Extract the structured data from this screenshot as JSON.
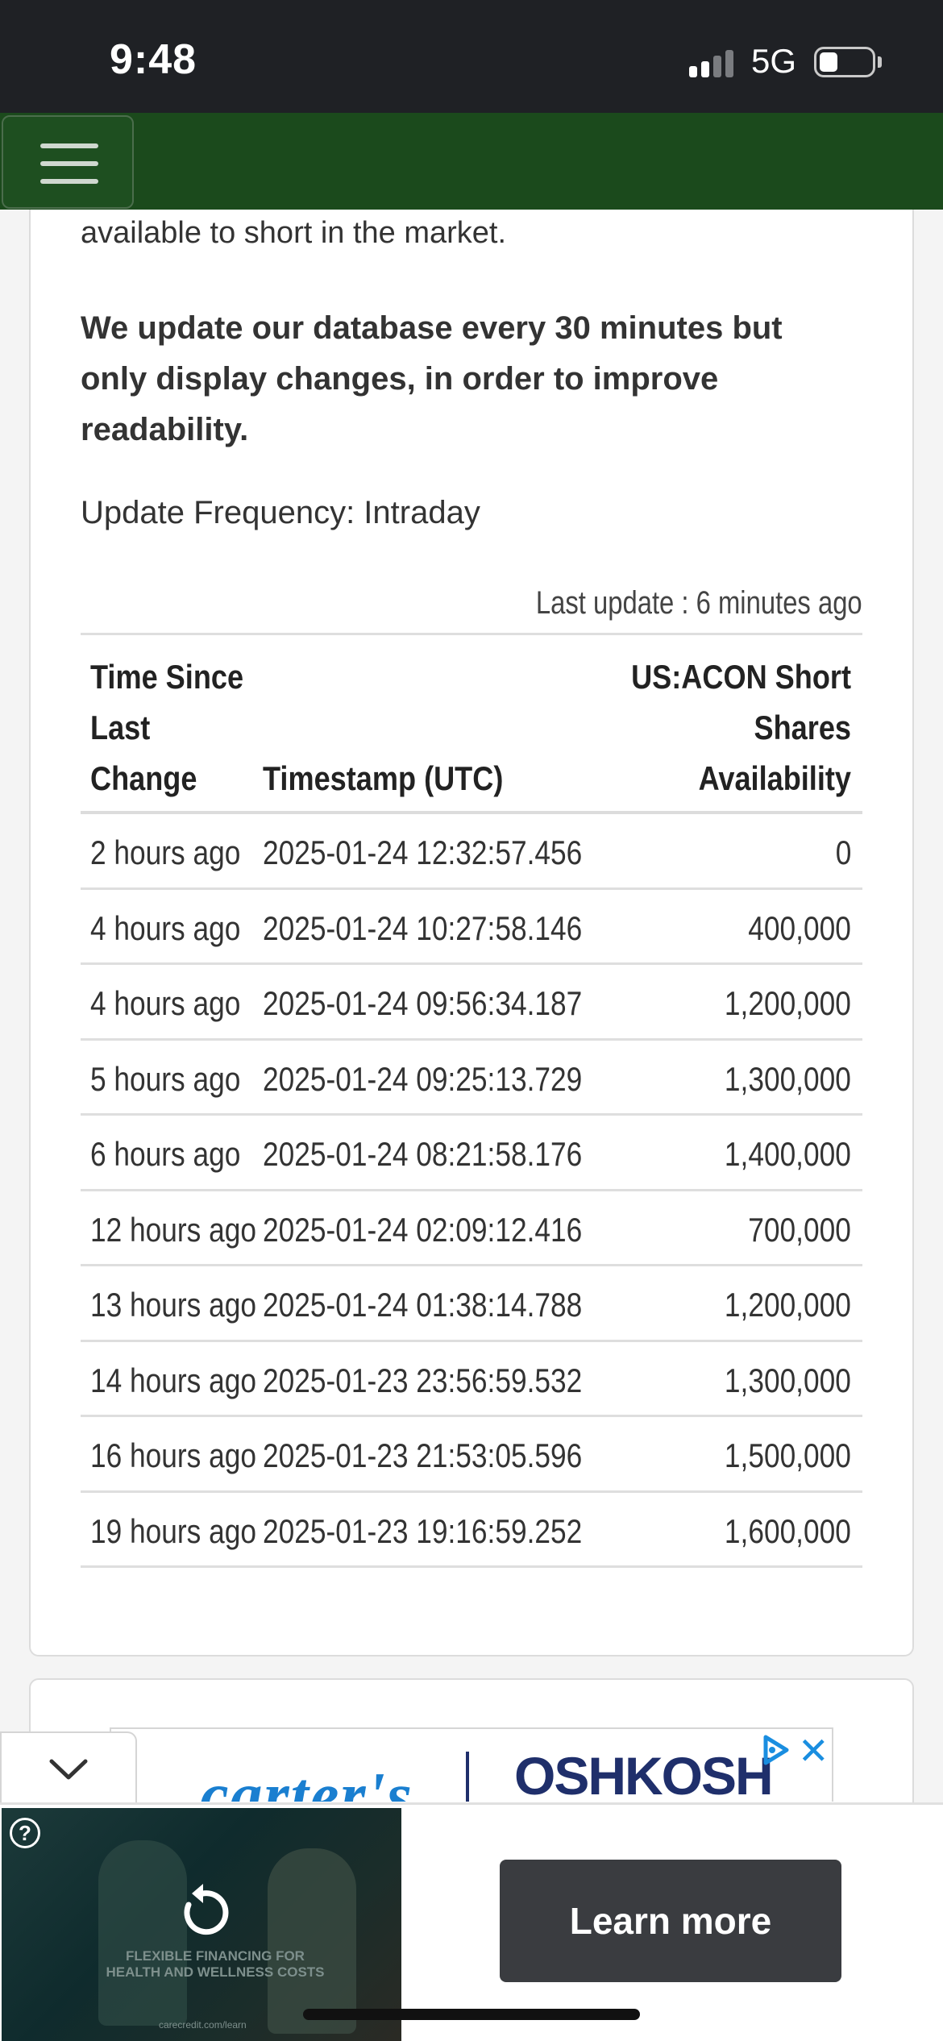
{
  "status_bar": {
    "time": "9:48",
    "network": "5G",
    "battery_level": 0.3
  },
  "nav": {
    "menu_icon": "hamburger-icon",
    "color": "#1b4a1c"
  },
  "content": {
    "intro_tail": "available to short in the market.",
    "update_note": "We update our database every 30 minutes but only display changes, in order to improve readability.",
    "frequency": "Update Frequency: Intraday",
    "last_update": "Last update : 6 minutes ago"
  },
  "table": {
    "headers": {
      "since": "Time Since Last Change",
      "timestamp": "Timestamp (UTC)",
      "availability": "US:ACON Short Shares Availability"
    },
    "rows": [
      {
        "since": "2 hours ago",
        "timestamp": "2025-01-24 12:32:57.456",
        "value": "0"
      },
      {
        "since": "4 hours ago",
        "timestamp": "2025-01-24 10:27:58.146",
        "value": "400,000"
      },
      {
        "since": "4 hours ago",
        "timestamp": "2025-01-24 09:56:34.187",
        "value": "1,200,000"
      },
      {
        "since": "5 hours ago",
        "timestamp": "2025-01-24 09:25:13.729",
        "value": "1,300,000"
      },
      {
        "since": "6 hours ago",
        "timestamp": "2025-01-24 08:21:58.176",
        "value": "1,400,000"
      },
      {
        "since": "12 hours ago",
        "timestamp": "2025-01-24 02:09:12.416",
        "value": "700,000"
      },
      {
        "since": "13 hours ago",
        "timestamp": "2025-01-24 01:38:14.788",
        "value": "1,200,000"
      },
      {
        "since": "14 hours ago",
        "timestamp": "2025-01-23 23:56:59.532",
        "value": "1,300,000"
      },
      {
        "since": "16 hours ago",
        "timestamp": "2025-01-23 21:53:05.596",
        "value": "1,500,000"
      },
      {
        "since": "19 hours ago",
        "timestamp": "2025-01-23 19:16:59.252",
        "value": "1,600,000"
      }
    ]
  },
  "ads": {
    "banner_brand_1": "carter's",
    "banner_brand_2": "OSHKOSH",
    "video_caption": "FLEXIBLE FINANCING FOR HEALTH AND WELLNESS COSTS",
    "video_url": "carecredit.com/learn",
    "learn_more": "Learn more",
    "help": "?"
  }
}
